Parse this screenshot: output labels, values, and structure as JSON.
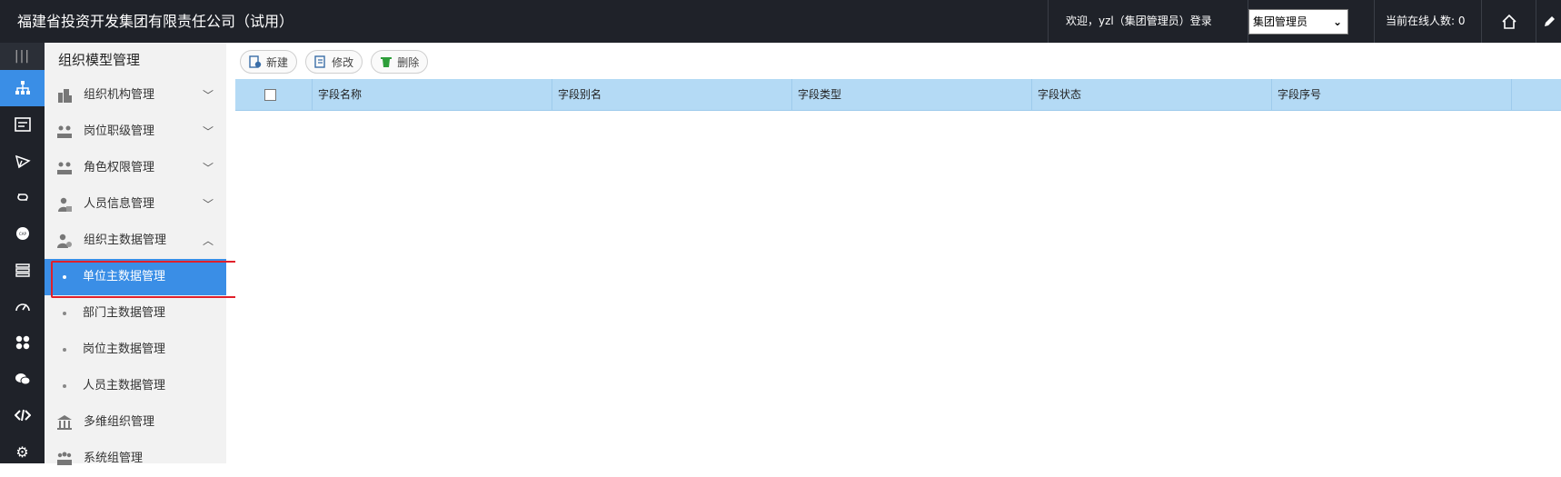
{
  "header": {
    "title": "福建省投资开发集团有限责任公司（试用）",
    "welcome": "欢迎，yzl（集团管理员）登录",
    "role_select": {
      "selected": "集团管理员"
    },
    "online": "当前在线人数: 0",
    "home_icon": "home-icon",
    "edit_icon": "pencil-icon"
  },
  "rail": {
    "items": [
      "menu-icon",
      "org-tree-icon",
      "card-icon",
      "send-icon",
      "link-icon",
      "cap-icon",
      "stack-icon",
      "gauge-icon",
      "apps-icon",
      "chat-icon",
      "code-icon",
      "gear-icon"
    ]
  },
  "sidebar": {
    "title": "组织模型管理",
    "items": [
      {
        "label": "组织机构管理",
        "icon": "building-icon",
        "expanded": false
      },
      {
        "label": "岗位职级管理",
        "icon": "people-icon",
        "expanded": false
      },
      {
        "label": "角色权限管理",
        "icon": "people-icon",
        "expanded": false
      },
      {
        "label": "人员信息管理",
        "icon": "user-card-icon",
        "expanded": false
      },
      {
        "label": "组织主数据管理",
        "icon": "user-gear-icon",
        "expanded": true
      }
    ],
    "subitems": [
      {
        "label": "单位主数据管理",
        "active": true
      },
      {
        "label": "部门主数据管理",
        "active": false
      },
      {
        "label": "岗位主数据管理",
        "active": false
      },
      {
        "label": "人员主数据管理",
        "active": false
      }
    ],
    "more_items": [
      {
        "label": "多维组织管理",
        "icon": "bank-icon"
      },
      {
        "label": "系统组管理",
        "icon": "group-icon"
      }
    ]
  },
  "toolbar": {
    "new_label": "新建",
    "edit_label": "修改",
    "delete_label": "删除"
  },
  "grid": {
    "columns": [
      "字段名称",
      "字段别名",
      "字段类型",
      "字段状态",
      "字段序号"
    ],
    "rows": []
  },
  "colors": {
    "header_bg": "#1f2229",
    "accent": "#3a8ee6",
    "grid_header": "#b4daf5",
    "highlight": "#e0202b"
  }
}
